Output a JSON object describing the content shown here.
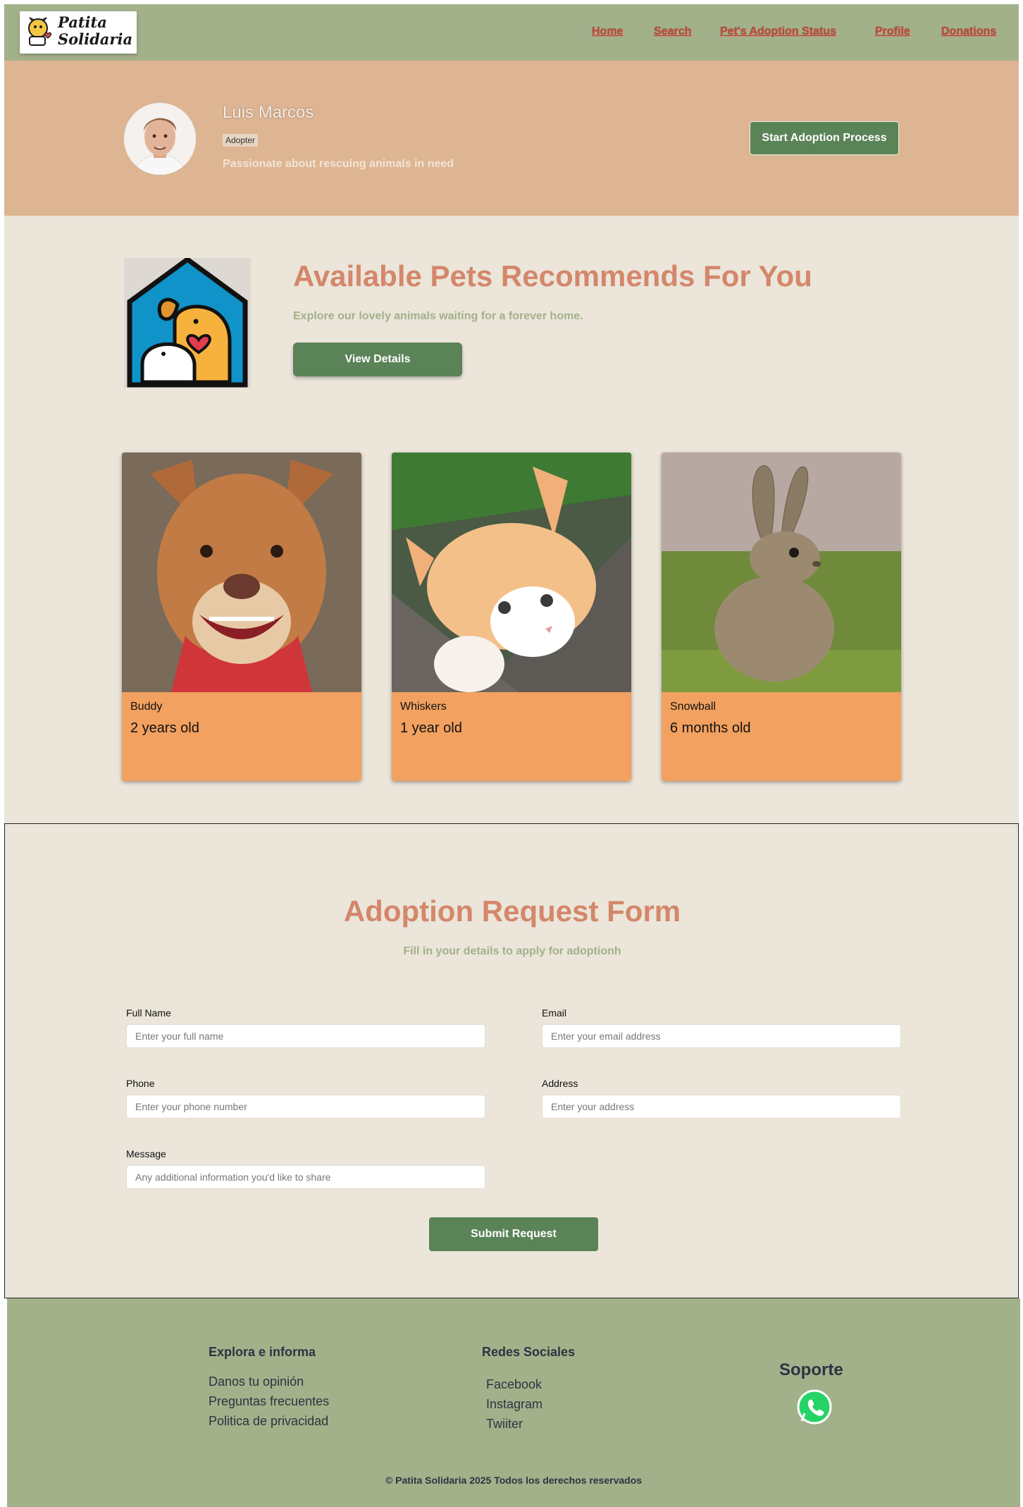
{
  "nav": {
    "logo_line1": "Patita",
    "logo_line2": "Solidaria",
    "links": [
      "Home",
      "Search",
      "Pet's Adoption Status",
      "Profile",
      "Donations"
    ]
  },
  "profile": {
    "name": "Luis Marcos",
    "role": "Adopter",
    "tagline": "Passionate about rescuing animals in need",
    "start_button": "Start Adoption Process"
  },
  "recommend": {
    "title": "Available Pets Recommends For You",
    "subtitle": "Explore our lovely animals waiting for a forever home.",
    "view_button": "View Details"
  },
  "pets": [
    {
      "name": "Buddy",
      "age": "2 years old",
      "photo_icon": "dog-photo"
    },
    {
      "name": "Whiskers",
      "age": "1 year old",
      "photo_icon": "cat-photo"
    },
    {
      "name": "Snowball",
      "age": "6 months old",
      "photo_icon": "rabbit-photo"
    }
  ],
  "form": {
    "title": "Adoption Request Form",
    "subtitle": "Fill in your details to apply for adoptionh",
    "full_name_label": "Full Name",
    "full_name_placeholder": "Enter your full name",
    "email_label": "Email",
    "email_placeholder": "Enter your email address",
    "phone_label": "Phone",
    "phone_placeholder": "Enter your phone number",
    "address_label": "Address",
    "address_placeholder": "Enter your address",
    "message_label": "Message",
    "message_placeholder": "Any additional information you'd like to share",
    "submit_button": "Submit Request"
  },
  "footer": {
    "explore_heading": "Explora e informa",
    "explore_links": [
      "Danos tu opinión",
      "Preguntas frecuentes",
      "Politica de privacidad"
    ],
    "social_heading": "Redes Sociales",
    "social_links": [
      "Facebook",
      "Instagram",
      "Twiiter"
    ],
    "support_heading": "Soporte",
    "support_icon": "whatsapp-icon",
    "copyright": "© Patita Solidaria 2025 Todos los derechos reservados"
  },
  "colors": {
    "nav_bg": "#a3b18a",
    "banner_bg": "#ddb593",
    "section_bg": "#ebe5da",
    "accent_green": "#5b8358",
    "title_salmon": "#d4876a",
    "card_orange": "#f2a160",
    "nav_link": "#b5513e"
  }
}
